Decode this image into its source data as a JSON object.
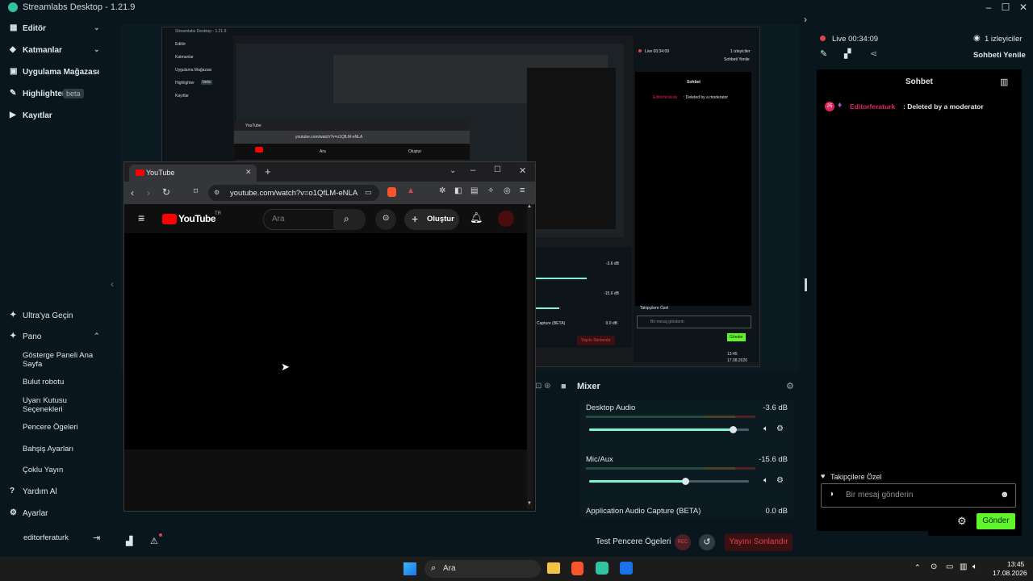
{
  "app": {
    "title": "Streamlabs Desktop - 1.21.9"
  },
  "sidebar": {
    "items": [
      {
        "label": "Editör",
        "icon": "editor-icon"
      },
      {
        "label": "Katmanlar",
        "icon": "layers-icon"
      },
      {
        "label": "Uygulama Mağazası",
        "icon": "store-icon"
      },
      {
        "label": "Highlighter",
        "badge": "beta",
        "icon": "highlighter-icon"
      },
      {
        "label": "Kayıtlar",
        "icon": "recordings-icon"
      }
    ],
    "ultra": "Ultra'ya Geçin",
    "pano": "Pano",
    "pano_items": [
      "Gösterge Paneli Ana Sayfa",
      "Bulut robotu",
      "Uyarı Kutusu Seçenekleri",
      "Pencere Ögeleri",
      "Bahşiş Ayarları",
      "Çoklu Yayın"
    ],
    "help": "Yardım Al",
    "settings": "Ayarlar",
    "user": "editorferaturk"
  },
  "browser": {
    "tab_title": "YouTube",
    "url": "youtube.com/watch?v=o1QfLM-eNLA",
    "yt_logo": "YouTube",
    "yt_region": "TR",
    "search_placeholder": "Ara",
    "create_label": "Oluştur"
  },
  "nested": {
    "title": "Streamlabs Desktop - 1.21.9",
    "sidebar": [
      "Editör",
      "Katmanlar",
      "Uygulama Mağazası",
      "Highlighter",
      "Kayıtlar"
    ],
    "badge": "beta",
    "live": "Live 00:34:09",
    "viewers": "1 izleyiciler",
    "refresh": "Sohbeti Yenile",
    "chat_title": "Sohbet",
    "message_user": "Editorferaturk",
    "message_text": ": Deleted by a moderator",
    "desktop_db": "-3.6 dB",
    "mic_db": "-15.6 dB",
    "app_audio": "Capture (BETA)",
    "app_db": "0.0 dB",
    "followers": "Takipçilere Özel",
    "placeholder": "Bir mesaj gönderin",
    "send": "Gönder",
    "end": "Yayını Sonlandır",
    "time": "13:45",
    "date": "17.08.2026",
    "inner_tab": "YouTube",
    "inner_url": "youtube.com/watch?v=o1QfLM-eNLA",
    "inner_search": "Ara",
    "inner_create": "Oluştur"
  },
  "mixer": {
    "title": "Mixer",
    "tracks": [
      {
        "name": "Desktop Audio",
        "db": "-3.6 dB",
        "level": 0.9
      },
      {
        "name": "Mic/Aux",
        "db": "-15.6 dB",
        "level": 0.6
      },
      {
        "name": "Application Audio Capture (BETA)",
        "db": "0.0 dB"
      }
    ]
  },
  "chat": {
    "live": "Live 00:34:09",
    "viewers": "1 izleyiciler",
    "refresh": "Sohbeti Yenile",
    "title": "Sohbet",
    "message": {
      "badge": "25",
      "user": "Editorferaturk",
      "text": ": Deleted by a moderator"
    },
    "followers_only": "Takipçilere Özel",
    "input_placeholder": "Bir mesaj gönderin",
    "send": "Gönder"
  },
  "bottom": {
    "test_label": "Test Pencere Ögeleri",
    "rec": "REC",
    "end_stream": "Yayını Sonlandır"
  },
  "taskbar": {
    "search": "Ara",
    "time": "13:45",
    "date": "17.08.2026"
  },
  "colors": {
    "accent": "#80f5d2",
    "send_green": "#5ef52c",
    "danger": "#e0434a",
    "brand_red": "#e0245e"
  }
}
